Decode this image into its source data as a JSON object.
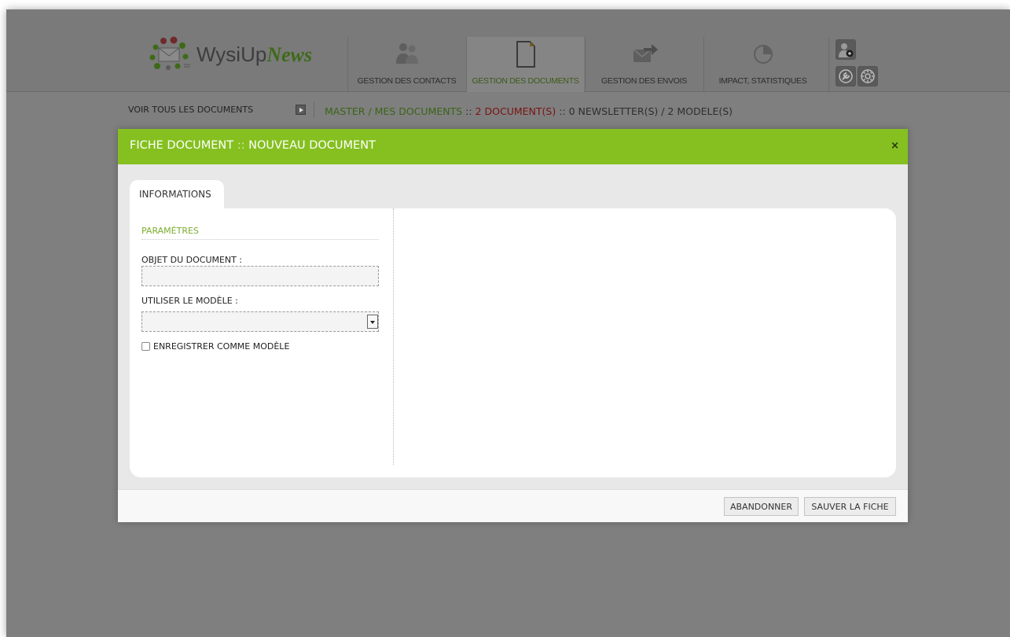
{
  "app": {
    "logo_main": "WysiUp",
    "logo_accent": "News"
  },
  "nav": {
    "contacts": "GESTION DES CONTACTS",
    "documents": "GESTION DES DOCUMENTS",
    "envois": "GESTION DES ENVOIS",
    "stats": "IMPACT, STATISTIQUES"
  },
  "breadcrumb": {
    "left": "VOIR TOUS LES DOCUMENTS",
    "path": "MASTER / MES DOCUMENTS",
    "sep1": "::",
    "documents": "2 DOCUMENT(S)",
    "sep2": ":: 0 NEWSLETTER(S) / 2 MODELE(S)"
  },
  "modal": {
    "title_main": "FICHE DOCUMENT",
    "title_sep": "::",
    "title_sub": "NOUVEAU DOCUMENT",
    "close": "×",
    "tab": "INFORMATIONS",
    "section_title": "PARAMÉTRES",
    "object_label": "OBJET DU DOCUMENT :",
    "object_value": "",
    "model_label": "UTILISER LE MODÈLE :",
    "model_value": "",
    "save_as_model_label": "ENREGISTRER COMME MODÈLE",
    "cancel_button": "ABANDONNER",
    "save_button": "SAUVER LA FICHE"
  },
  "colors": {
    "accent_green": "#85c020",
    "section_green": "#7cac2e",
    "overlay_gray": "#7f7f7f",
    "breadcrumb_red": "#7a1313"
  }
}
